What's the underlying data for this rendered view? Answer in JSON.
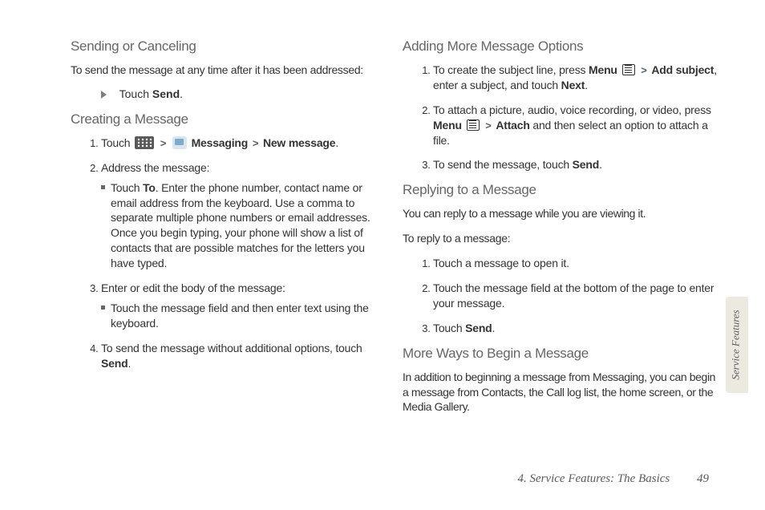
{
  "left": {
    "h_sending": "Sending or Canceling",
    "sending_intro": "To send the message at any time after it has been addressed:",
    "bullet_touch": "Touch ",
    "bullet_send": "Send",
    "bullet_period": ".",
    "h_creating": "Creating a Message",
    "c1_a": "Touch  ",
    "c1_msg": " Messaging",
    "c1_new": "New message",
    "c1_dot": ".",
    "c2": "Address the message:",
    "c2_sub_a": "Touch ",
    "c2_sub_to": "To",
    "c2_sub_b": ". Enter the phone number, contact name or email address from the keyboard. Use a comma to separate multiple phone numbers or email addresses. Once you begin typing, your phone will show a list of contacts that are possible matches for the letters you have typed.",
    "c3": "Enter or edit the body of the message:",
    "c3_sub": "Touch the message field and then enter text using the keyboard.",
    "c4_a": "To send the message without additional options, touch ",
    "c4_send": "Send",
    "c4_dot": "."
  },
  "right": {
    "h_adding": "Adding More Message Options",
    "a1_a": "To create the subject line, press ",
    "a1_menu": "Menu",
    "a1_b": " ",
    "a1_add": "Add subject",
    "a1_c": ", enter a subject, and touch ",
    "a1_next": "Next",
    "a1_dot": ".",
    "a2_a": "To attach a picture, audio, voice recording, or video, press ",
    "a2_menu": "Menu",
    "a2_attach": "Attach",
    "a2_b": " and then select an option to attach a file.",
    "a3_a": "To send the message, touch ",
    "a3_send": "Send",
    "a3_dot": ".",
    "h_reply": "Replying to a Message",
    "reply_intro": "You can reply to a message while you are viewing it.",
    "reply_to": "To reply to a message:",
    "r1": "Touch a message to open it.",
    "r2": "Touch the message field at the bottom of the page to enter your message.",
    "r3_a": "Touch ",
    "r3_send": "Send",
    "r3_dot": ".",
    "h_more": "More Ways to Begin a Message",
    "more_p": "In addition to beginning a message from Messaging, you can begin a message from Contacts, the Call log list, the home screen, or the Media Gallery."
  },
  "side": "Service Features",
  "footer_title": "4. Service Features: The Basics",
  "footer_page": "49",
  "gt": ">"
}
